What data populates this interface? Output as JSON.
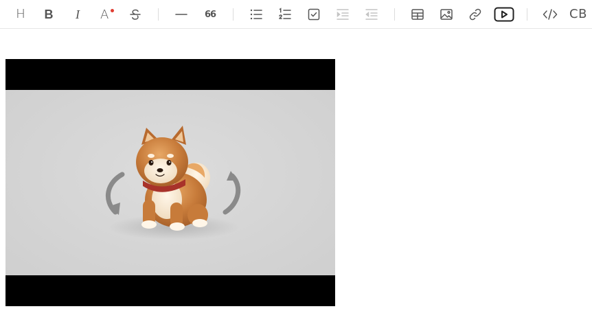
{
  "toolbar": {
    "heading_label": "H",
    "bold_label": "B",
    "italic_label": "I",
    "font_color_label": "A",
    "font_color_dot": "#e03c31",
    "quote_label": "66",
    "code_block_label": "CB"
  },
  "video": {
    "thumbnail": "shiba-inu-dog-icon"
  }
}
